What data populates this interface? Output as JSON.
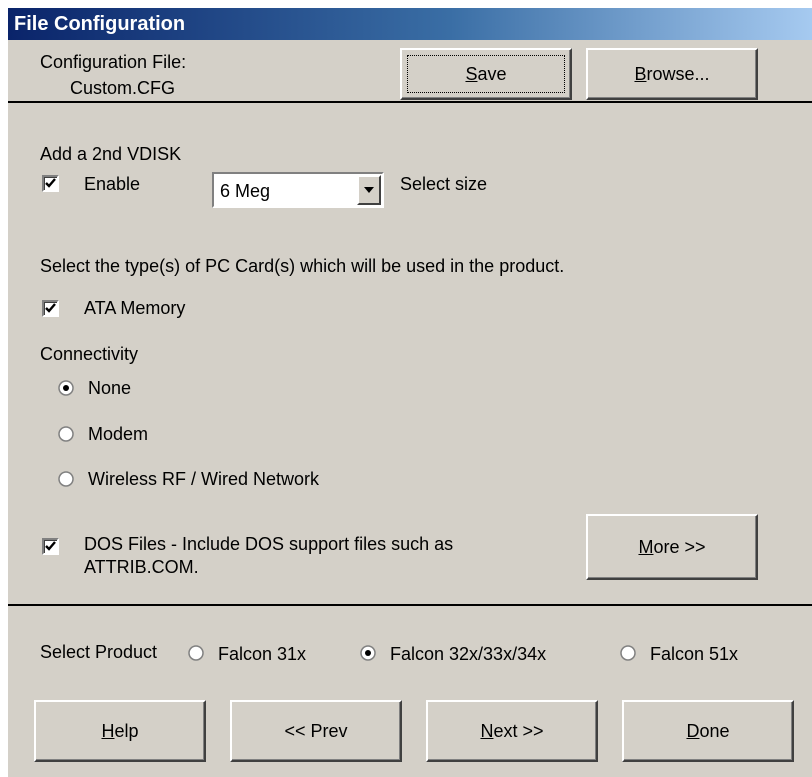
{
  "window": {
    "title": "File Configuration"
  },
  "config_file": {
    "label": "Configuration File:",
    "value": "Custom.CFG"
  },
  "toolbar": {
    "save_label": "Save",
    "browse_label": "Browse..."
  },
  "vdisk": {
    "heading": "Add a 2nd VDISK",
    "enable_label": "Enable",
    "enable_checked": true,
    "size_value": "6 Meg",
    "size_label": "Select size"
  },
  "pc_card": {
    "prompt": "Select the type(s) of PC Card(s) which will be used in the product.",
    "ata_label": "ATA Memory",
    "ata_checked": true
  },
  "connectivity": {
    "heading": "Connectivity",
    "options": [
      "None",
      "Modem",
      "Wireless RF / Wired Network"
    ],
    "selected": "None"
  },
  "dos_files": {
    "line1": "DOS Files - Include DOS support files such as",
    "line2": "ATTRIB.COM.",
    "checked": true,
    "more_label": "More >>"
  },
  "product": {
    "label": "Select Product",
    "options": [
      "Falcon 31x",
      "Falcon 32x/33x/34x",
      "Falcon 51x"
    ],
    "selected": "Falcon 32x/33x/34x"
  },
  "footer": {
    "help_label": "Help",
    "prev_label": "<< Prev",
    "next_label": "Next >>",
    "done_label": "Done"
  }
}
